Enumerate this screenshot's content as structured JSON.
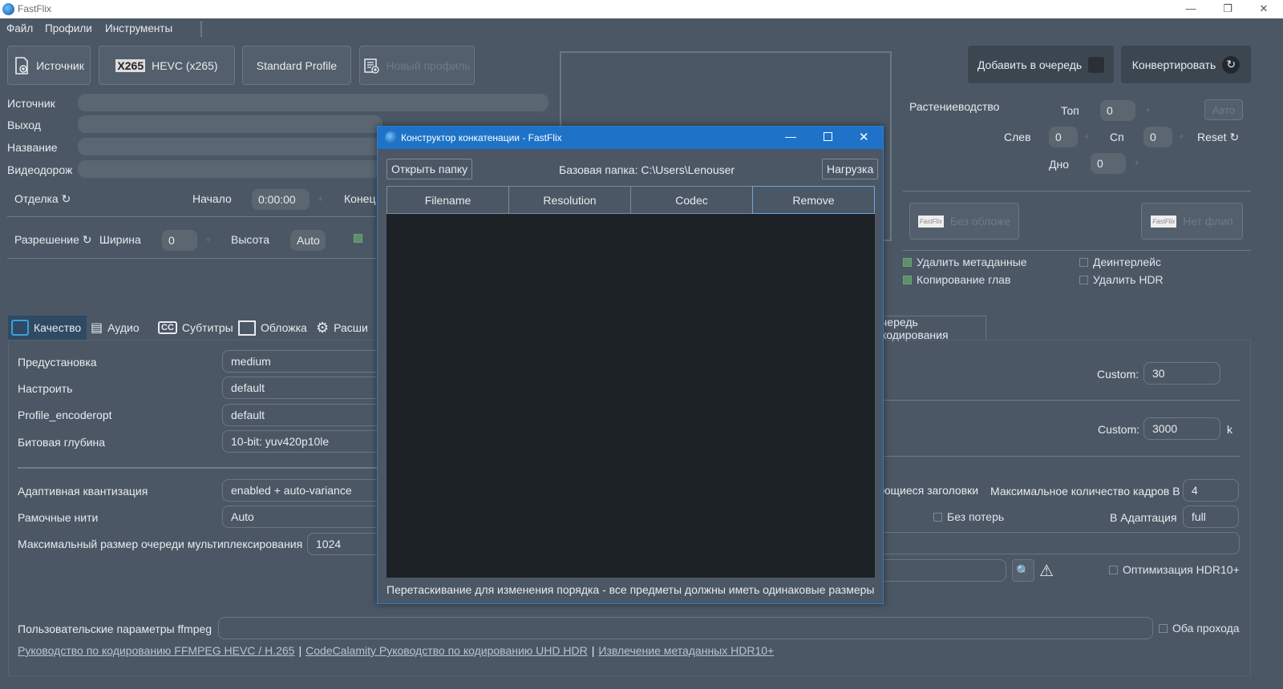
{
  "app": {
    "title": "FastFlix"
  },
  "menu": [
    "Файл",
    "Профили",
    "Инструменты"
  ],
  "toolbar": {
    "source_btn": "Источник",
    "encoder_logo": "X265",
    "encoder_btn": "HEVC (x265)",
    "profile_btn": "Standard Profile",
    "new_profile_btn": "Новый профиль",
    "queue_btn": "Добавить в очередь",
    "convert_btn": "Конвертировать"
  },
  "fields": {
    "source": "Источник",
    "output": "Выход",
    "title": "Название",
    "video_track": "Видеодорож",
    "trim": "Отделка",
    "start": "Начало",
    "start_value": "0:00:00",
    "end": "Конец",
    "resolution": "Разрешение",
    "width": "Ширина",
    "width_value": "0",
    "height": "Высота",
    "height_value": "Auto"
  },
  "crop": {
    "label": "Растениеводство",
    "top": "Топ",
    "top_value": "0",
    "auto": "Авто",
    "left": "Слев",
    "left_value": "0",
    "right": "Сп",
    "right_value": "0",
    "reset": "Reset",
    "bottom": "Дно",
    "bottom_value": "0"
  },
  "watermarks": {
    "no_cover": "Без обложе",
    "no_flip": "Нет флип",
    "logo_text": "FastFlix"
  },
  "options": {
    "remove_metadata": "Удалить метаданные",
    "copy_chapters": "Копирование глав",
    "deinterlace": "Деинтерлейс",
    "remove_hdr": "Удалить HDR"
  },
  "tabs": [
    "Качество",
    "Аудио",
    "Субтитры",
    "Обложка",
    "Расши"
  ],
  "queue_tab": "чередь кодирования",
  "quality": {
    "preset_label": "Предустановка",
    "preset": "medium",
    "tune_label": "Настроить",
    "tune": "default",
    "profile_label": "Profile_encoderopt",
    "profile": "default",
    "bitdepth_label": "Битовая глубина",
    "bitdepth": "10-bit: yuv420p10le",
    "aq_label": "Адаптивная квантизация",
    "aq": "enabled + auto-variance",
    "frame_threads_label": "Рамочные нити",
    "frame_threads": "Auto",
    "mux_label": "Максимальный размер очереди мультиплексирования",
    "mux": "1024",
    "custom_label": "Custom:",
    "custom_crf": "30",
    "custom_bitrate": "3000",
    "bitrate_unit": "k",
    "repeat_headers": "ющиеся заголовки",
    "max_frames_label": "Максимальное количество кадров В",
    "max_frames": "4",
    "lossless": "Без потерь",
    "b_adapt_label": "В Адаптация",
    "b_adapt": "full",
    "hdr10_opt": "Оптимизация HDR10+",
    "ffmpeg_label": "Пользовательские параметры ffmpeg",
    "both_passes": "Оба прохода"
  },
  "links": [
    "Руководство по кодированию FFMPEG HEVC / H.265",
    "CodeCalamity Руководство по кодированию UHD HDR",
    "Извлечение метаданных HDR10+"
  ],
  "link_sep": "|",
  "dialog": {
    "title": "Конструктор конкатенации - FastFlix",
    "open_folder": "Открыть папку",
    "base_folder": "Базовая папка: C:\\Users\\Lenouser",
    "load": "Нагрузка",
    "columns": [
      "Filename",
      "Resolution",
      "Codec",
      "Remove"
    ],
    "hint": "Перетаскивание для изменения порядка - все предметы должны иметь одинаковые размеры"
  },
  "colors": {
    "accent": "#1e73c8",
    "bg": "#4b5765",
    "table_bg": "#1d2226"
  }
}
